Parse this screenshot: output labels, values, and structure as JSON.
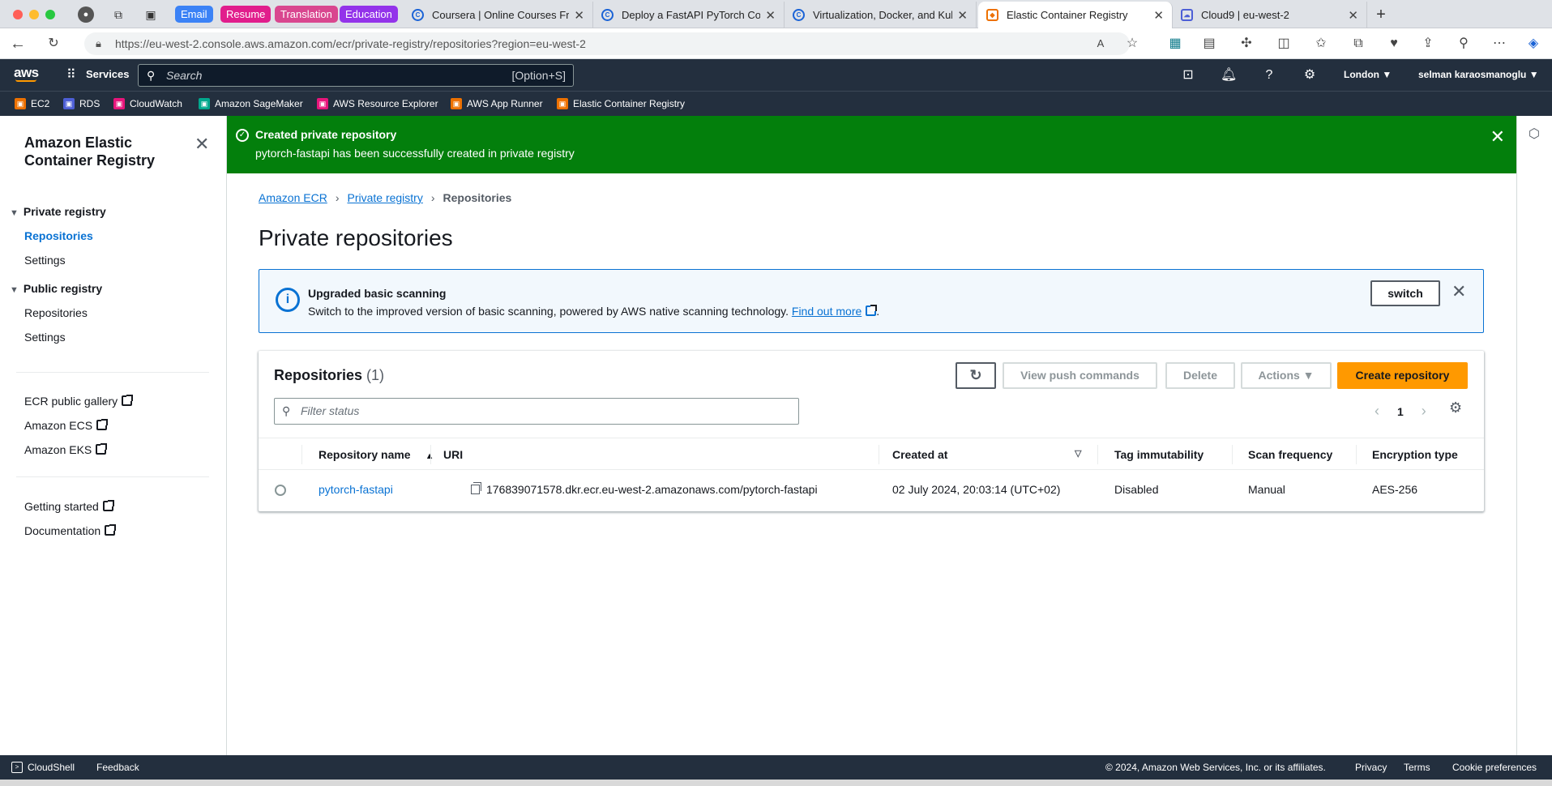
{
  "browser": {
    "tab_groups": [
      {
        "label": "Email",
        "color": "#3b82f6"
      },
      {
        "label": "Resume",
        "color": "#e11d8c"
      },
      {
        "label": "Translation",
        "color": "#d9468f"
      },
      {
        "label": "Education",
        "color": "#9333ea"
      }
    ],
    "tabs": [
      {
        "title": "Coursera | Online Courses From"
      },
      {
        "title": "Deploy a FastAPI PyTorch Cont"
      },
      {
        "title": "Virtualization, Docker, and Kub"
      },
      {
        "title": "Elastic Container Registry"
      },
      {
        "title": "Cloud9 | eu-west-2"
      }
    ],
    "url_host": "https://eu-west-2.console.aws.amazon.com",
    "url_path": "/ecr/private-registry/repositories?region=eu-west-2"
  },
  "awsnav": {
    "logo": "aws",
    "services": "Services",
    "search_placeholder": "Search",
    "search_shortcut": "[Option+S]",
    "region": "London ▼",
    "user": "selman karaosmanoglu ▼"
  },
  "favorites": [
    {
      "label": "EC2",
      "color": "#ed7100"
    },
    {
      "label": "RDS",
      "color": "#4d5fd6"
    },
    {
      "label": "CloudWatch",
      "color": "#e7157b"
    },
    {
      "label": "Amazon SageMaker",
      "color": "#01a88d"
    },
    {
      "label": "AWS Resource Explorer",
      "color": "#e7157b"
    },
    {
      "label": "AWS App Runner",
      "color": "#ed7100"
    },
    {
      "label": "Elastic Container Registry",
      "color": "#ed7100"
    }
  ],
  "sidebar": {
    "title": "Amazon Elastic Container Registry",
    "private_registry": "Private registry",
    "private_items": [
      "Repositories",
      "Settings"
    ],
    "public_registry": "Public registry",
    "public_items": [
      "Repositories",
      "Settings"
    ],
    "links1": [
      "ECR public gallery",
      "Amazon ECS",
      "Amazon EKS"
    ],
    "links2": [
      "Getting started",
      "Documentation"
    ]
  },
  "flash": {
    "heading": "Created private repository",
    "message": "pytorch-fastapi has been successfully created in private registry"
  },
  "breadcrumbs": [
    "Amazon ECR",
    "Private registry",
    "Repositories"
  ],
  "page_title": "Private repositories",
  "info": {
    "heading": "Upgraded basic scanning",
    "message": "Switch to the improved version of basic scanning, powered by AWS native scanning technology.",
    "link": "Find out more",
    "switch_label": "switch"
  },
  "repositories": {
    "title": "Repositories",
    "count": "(1)",
    "buttons": {
      "view_push": "View push commands",
      "delete": "Delete",
      "actions": "Actions ▼",
      "create": "Create repository"
    },
    "filter_placeholder": "Filter status",
    "page": "1",
    "columns": [
      "Repository name",
      "URI",
      "Created at",
      "Tag immutability",
      "Scan frequency",
      "Encryption type"
    ],
    "rows": [
      {
        "name": "pytorch-fastapi",
        "uri": "176839071578.dkr.ecr.eu-west-2.amazonaws.com/pytorch-fastapi",
        "created": "02 July 2024, 20:03:14 (UTC+02)",
        "tag_immutability": "Disabled",
        "scan_frequency": "Manual",
        "encryption": "AES-256"
      }
    ]
  },
  "footer": {
    "cloudshell": "CloudShell",
    "feedback": "Feedback",
    "copyright": "© 2024, Amazon Web Services, Inc. or its affiliates.",
    "privacy": "Privacy",
    "terms": "Terms",
    "cookies": "Cookie preferences"
  }
}
